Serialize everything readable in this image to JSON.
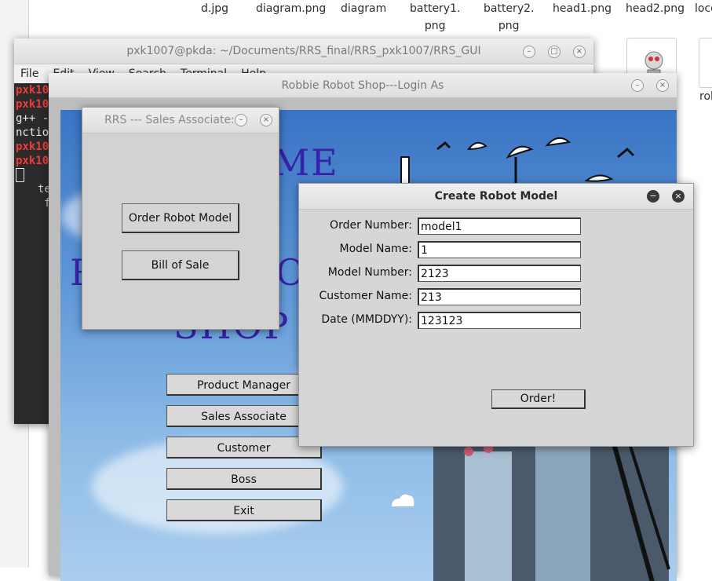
{
  "file_manager": {
    "files": [
      {
        "label": "d.jpg"
      },
      {
        "label": "diagram.png"
      },
      {
        "label": "diagram"
      },
      {
        "label": "battery1.\npng"
      },
      {
        "label": "battery2.\npng"
      },
      {
        "label": "head1.png"
      },
      {
        "label": "head2.png"
      },
      {
        "label": "loco"
      }
    ],
    "partial_label": "rob"
  },
  "terminal": {
    "title": "pxk1007@pkda: ~/Documents/RRS_final/RRS_pxk1007/RRS_GUI",
    "menu": [
      "File",
      "Edit",
      "View",
      "Search",
      "Terminal",
      "Help"
    ],
    "lines": [
      {
        "text": "pxk10",
        "red": true
      },
      {
        "text": "pxk10",
        "red": true
      },
      {
        "text": "g++ -",
        "red": false
      },
      {
        "text": "nctio",
        "red": false
      },
      {
        "text": "pxk10",
        "red": true
      },
      {
        "text": "pxk10",
        "red": true
      }
    ],
    "extra_1": "te",
    "extra_2": "f"
  },
  "login": {
    "title": "Robbie Robot Shop---Login As",
    "banner_1": "ME",
    "banner_2": "R",
    "banner_3": "O",
    "banner_4": "SHOP",
    "buttons": [
      "Product Manager",
      "Sales Associate",
      "Customer",
      "Boss",
      "Exit"
    ]
  },
  "sales": {
    "title": "RRS --- Sales Associate:",
    "order_label": "Order Robot Model",
    "bill_label": "Bill of Sale"
  },
  "create": {
    "title": "Create Robot Model",
    "fields": [
      {
        "label": "Order Number:",
        "value": "model1"
      },
      {
        "label": "Model Name:",
        "value": "1"
      },
      {
        "label": "Model Number:",
        "value": "2123"
      },
      {
        "label": "Customer Name:",
        "value": "213"
      },
      {
        "label": "Date (MMDDYY):",
        "value": "123123"
      }
    ],
    "order_button": "Order!"
  },
  "colors": {
    "banner_text": "#3922a8",
    "terminal_red": "#ef3b3b",
    "sky": "#5c95d6"
  },
  "icons": {
    "minimize": "minimize-icon",
    "maximize": "maximize-icon",
    "close": "close-icon"
  }
}
